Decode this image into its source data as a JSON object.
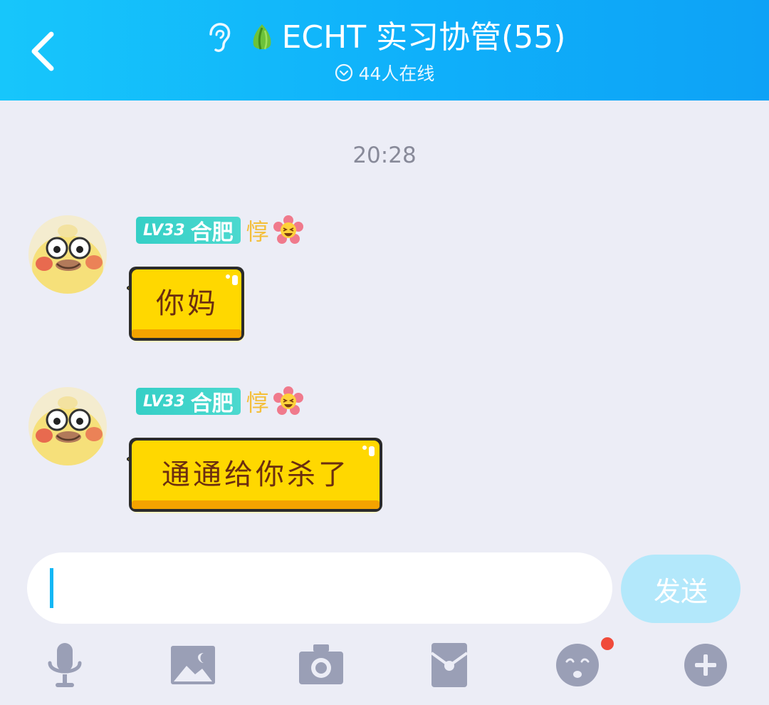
{
  "header": {
    "title": "ECHT 实习协管(55)",
    "online": "44人在线",
    "background": "#12b7f5"
  },
  "chat": {
    "timestamp": "20:28",
    "messages": [
      {
        "level": "LV33",
        "name": "合肥",
        "tag": "惇",
        "text": "你妈"
      },
      {
        "level": "LV33",
        "name": "合肥",
        "tag": "惇",
        "text": "通通给你杀了"
      }
    ]
  },
  "input": {
    "value": "",
    "send_label": "发送"
  },
  "toolbar": {
    "icons": [
      "microphone-icon",
      "image-icon",
      "camera-icon",
      "red-packet-icon",
      "emoji-icon",
      "plus-icon"
    ],
    "emoji_has_notification": true
  },
  "colors": {
    "accent": "#12b7f5",
    "bubble": "#ffd800",
    "level_badge": "#3fd4ca",
    "tag": "#f4bf3a",
    "icon_gray": "#9a9fb6"
  }
}
